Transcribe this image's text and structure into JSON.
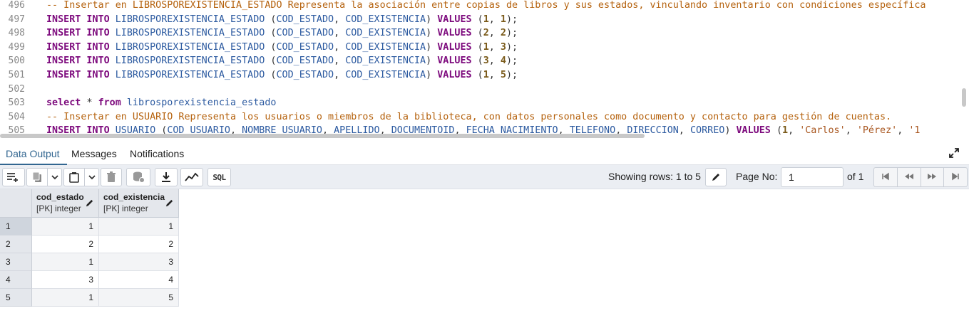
{
  "editor": {
    "lines": [
      {
        "num": "496",
        "tokens": [
          {
            "t": "cm",
            "v": "-- Insertar en LIBROSPOREXISTENCIA_ESTADO Representa la asociación entre copias de libros y sus estados, vinculando inventario con condiciones específica"
          }
        ]
      },
      {
        "num": "497",
        "tokens": [
          {
            "t": "kw",
            "v": "INSERT INTO "
          },
          {
            "t": "id",
            "v": "LIBROSPOREXISTENCIA_ESTADO "
          },
          {
            "t": "p",
            "v": "("
          },
          {
            "t": "id",
            "v": "COD_ESTADO"
          },
          {
            "t": "p",
            "v": ", "
          },
          {
            "t": "id",
            "v": "COD_EXISTENCIA"
          },
          {
            "t": "p",
            "v": ") "
          },
          {
            "t": "kw",
            "v": "VALUES "
          },
          {
            "t": "p",
            "v": "("
          },
          {
            "t": "num",
            "v": "1"
          },
          {
            "t": "p",
            "v": ", "
          },
          {
            "t": "num",
            "v": "1"
          },
          {
            "t": "p",
            "v": ");"
          }
        ]
      },
      {
        "num": "498",
        "tokens": [
          {
            "t": "kw",
            "v": "INSERT INTO "
          },
          {
            "t": "id",
            "v": "LIBROSPOREXISTENCIA_ESTADO "
          },
          {
            "t": "p",
            "v": "("
          },
          {
            "t": "id",
            "v": "COD_ESTADO"
          },
          {
            "t": "p",
            "v": ", "
          },
          {
            "t": "id",
            "v": "COD_EXISTENCIA"
          },
          {
            "t": "p",
            "v": ") "
          },
          {
            "t": "kw",
            "v": "VALUES "
          },
          {
            "t": "p",
            "v": "("
          },
          {
            "t": "num",
            "v": "2"
          },
          {
            "t": "p",
            "v": ", "
          },
          {
            "t": "num",
            "v": "2"
          },
          {
            "t": "p",
            "v": ");"
          }
        ]
      },
      {
        "num": "499",
        "tokens": [
          {
            "t": "kw",
            "v": "INSERT INTO "
          },
          {
            "t": "id",
            "v": "LIBROSPOREXISTENCIA_ESTADO "
          },
          {
            "t": "p",
            "v": "("
          },
          {
            "t": "id",
            "v": "COD_ESTADO"
          },
          {
            "t": "p",
            "v": ", "
          },
          {
            "t": "id",
            "v": "COD_EXISTENCIA"
          },
          {
            "t": "p",
            "v": ") "
          },
          {
            "t": "kw",
            "v": "VALUES "
          },
          {
            "t": "p",
            "v": "("
          },
          {
            "t": "num",
            "v": "1"
          },
          {
            "t": "p",
            "v": ", "
          },
          {
            "t": "num",
            "v": "3"
          },
          {
            "t": "p",
            "v": ");"
          }
        ]
      },
      {
        "num": "500",
        "tokens": [
          {
            "t": "kw",
            "v": "INSERT INTO "
          },
          {
            "t": "id",
            "v": "LIBROSPOREXISTENCIA_ESTADO "
          },
          {
            "t": "p",
            "v": "("
          },
          {
            "t": "id",
            "v": "COD_ESTADO"
          },
          {
            "t": "p",
            "v": ", "
          },
          {
            "t": "id",
            "v": "COD_EXISTENCIA"
          },
          {
            "t": "p",
            "v": ") "
          },
          {
            "t": "kw",
            "v": "VALUES "
          },
          {
            "t": "p",
            "v": "("
          },
          {
            "t": "num",
            "v": "3"
          },
          {
            "t": "p",
            "v": ", "
          },
          {
            "t": "num",
            "v": "4"
          },
          {
            "t": "p",
            "v": ");"
          }
        ]
      },
      {
        "num": "501",
        "tokens": [
          {
            "t": "kw",
            "v": "INSERT INTO "
          },
          {
            "t": "id",
            "v": "LIBROSPOREXISTENCIA_ESTADO "
          },
          {
            "t": "p",
            "v": "("
          },
          {
            "t": "id",
            "v": "COD_ESTADO"
          },
          {
            "t": "p",
            "v": ", "
          },
          {
            "t": "id",
            "v": "COD_EXISTENCIA"
          },
          {
            "t": "p",
            "v": ") "
          },
          {
            "t": "kw",
            "v": "VALUES "
          },
          {
            "t": "p",
            "v": "("
          },
          {
            "t": "num",
            "v": "1"
          },
          {
            "t": "p",
            "v": ", "
          },
          {
            "t": "num",
            "v": "5"
          },
          {
            "t": "p",
            "v": ");"
          }
        ]
      },
      {
        "num": "502",
        "tokens": []
      },
      {
        "num": "503",
        "tokens": [
          {
            "t": "kw",
            "v": "select "
          },
          {
            "t": "p",
            "v": "* "
          },
          {
            "t": "kw",
            "v": "from "
          },
          {
            "t": "id",
            "v": "librosporexistencia_estado"
          }
        ]
      },
      {
        "num": "504",
        "tokens": [
          {
            "t": "cm",
            "v": "-- Insertar en USUARIO Representa los usuarios o miembros de la biblioteca, con datos personales como documento y contacto para gestión de cuentas."
          }
        ]
      },
      {
        "num": "505",
        "tokens": [
          {
            "t": "kw",
            "v": "INSERT INTO "
          },
          {
            "t": "id",
            "v": "USUARIO "
          },
          {
            "t": "p",
            "v": "("
          },
          {
            "t": "id",
            "v": "COD_USUARIO"
          },
          {
            "t": "p",
            "v": ", "
          },
          {
            "t": "id",
            "v": "NOMBRE_USUARIO"
          },
          {
            "t": "p",
            "v": ", "
          },
          {
            "t": "id",
            "v": "APELLIDO"
          },
          {
            "t": "p",
            "v": ", "
          },
          {
            "t": "id",
            "v": "DOCUMENTOID"
          },
          {
            "t": "p",
            "v": ", "
          },
          {
            "t": "id",
            "v": "FECHA_NACIMIENTO"
          },
          {
            "t": "p",
            "v": ", "
          },
          {
            "t": "id",
            "v": "TELEFONO"
          },
          {
            "t": "p",
            "v": ", "
          },
          {
            "t": "id",
            "v": "DIRECCION"
          },
          {
            "t": "p",
            "v": ", "
          },
          {
            "t": "id",
            "v": "CORREO"
          },
          {
            "t": "p",
            "v": ") "
          },
          {
            "t": "kw",
            "v": "VALUES "
          },
          {
            "t": "p",
            "v": "("
          },
          {
            "t": "num",
            "v": "1"
          },
          {
            "t": "p",
            "v": ", "
          },
          {
            "t": "str",
            "v": "'Carlos'"
          },
          {
            "t": "p",
            "v": ", "
          },
          {
            "t": "str",
            "v": "'Pérez'"
          },
          {
            "t": "p",
            "v": ", "
          },
          {
            "t": "str",
            "v": "'1"
          }
        ]
      }
    ]
  },
  "tabs": {
    "data_output": "Data Output",
    "messages": "Messages",
    "notifications": "Notifications"
  },
  "toolbar": {
    "sql_label": "SQL",
    "showing_rows": "Showing rows: 1 to 5",
    "page_no_label": "Page No:",
    "page_no_value": "1",
    "of_label": "of 1",
    "icons": [
      "add-row-icon",
      "copy-icon",
      "chevron-down-icon",
      "paste-icon",
      "chevron-down-icon",
      "delete-icon",
      "save-data-icon",
      "download-icon",
      "graph-icon",
      "sql-icon",
      "edit-icon",
      "first-page-icon",
      "prev-page-icon",
      "next-page-icon",
      "last-page-icon"
    ]
  },
  "grid": {
    "columns": [
      {
        "name": "cod_estado",
        "type": "[PK] integer"
      },
      {
        "name": "cod_existencia",
        "type": "[PK] integer"
      }
    ],
    "rows": [
      {
        "num": "1",
        "cells": [
          "1",
          "1"
        ]
      },
      {
        "num": "2",
        "cells": [
          "2",
          "2"
        ]
      },
      {
        "num": "3",
        "cells": [
          "1",
          "3"
        ]
      },
      {
        "num": "4",
        "cells": [
          "3",
          "4"
        ]
      },
      {
        "num": "5",
        "cells": [
          "1",
          "5"
        ]
      }
    ]
  },
  "colors": {
    "accent": "#326690",
    "keyword": "#7d0a7d",
    "identifier": "#2c5aa0",
    "comment": "#b5620e",
    "number": "#7a5a1a"
  }
}
